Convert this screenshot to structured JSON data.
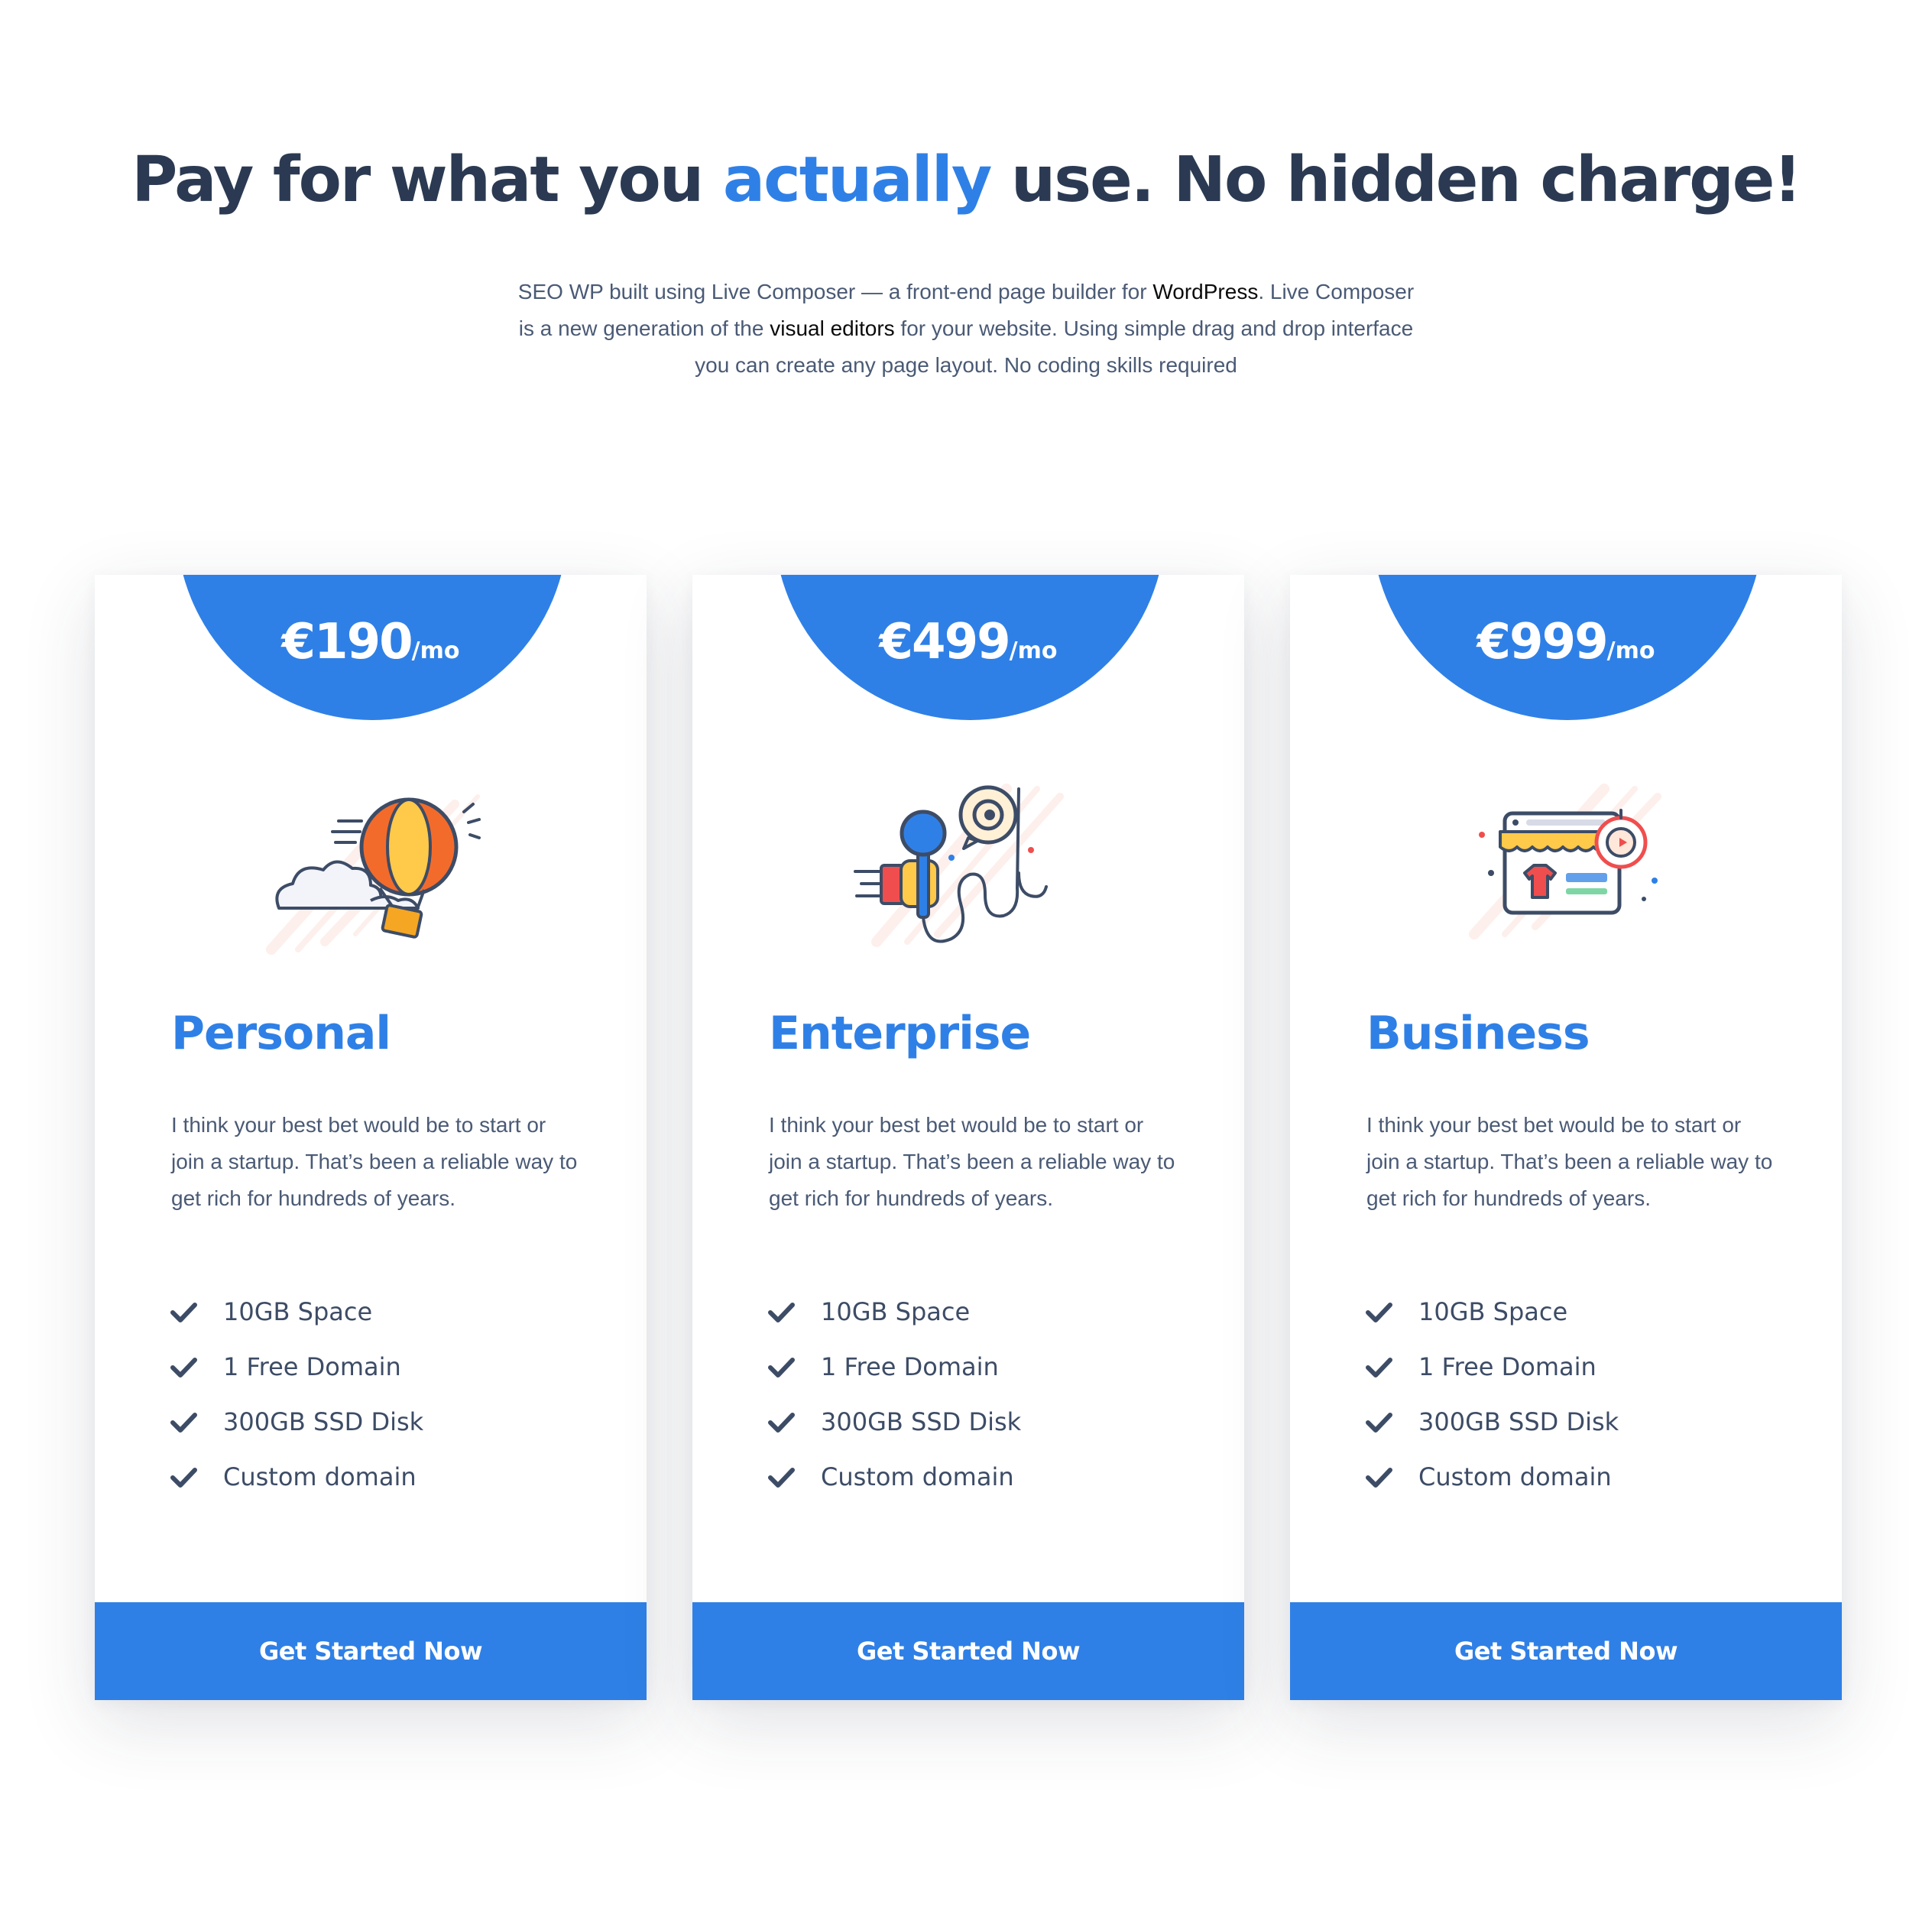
{
  "header": {
    "title_part1": "Pay for what you ",
    "title_accent": "actually",
    "title_part2": " use. No hidden charge!",
    "intro_part1": "SEO WP built using Live Composer — a front-end page builder for ",
    "intro_link1": "WordPress",
    "intro_part2": ". Live Composer is a new generation of the ",
    "intro_link2": "visual editors",
    "intro_part3": " for your website. Using simple drag and drop interface you can create any page layout. No coding skills required"
  },
  "plans": [
    {
      "price": "€190",
      "period": "/mo",
      "illustration": "hot-air-balloon-icon",
      "name": "Personal",
      "description": "I think your best bet would be to start or join a startup. That’s been a reliable way to get rich for hundreds of years.",
      "features": [
        "10GB Space",
        "1 Free Domain",
        "300GB SSD Disk",
        "Custom domain"
      ],
      "cta": "Get Started Now"
    },
    {
      "price": "€499",
      "period": "/mo",
      "illustration": "microphone-speech-icon",
      "name": "Enterprise",
      "description": "I think your best bet would be to start or join a startup. That’s been a reliable way to get rich for hundreds of years.",
      "features": [
        "10GB Space",
        "1 Free Domain",
        "300GB SSD Disk",
        "Custom domain"
      ],
      "cta": "Get Started Now"
    },
    {
      "price": "€999",
      "period": "/mo",
      "illustration": "online-store-icon",
      "name": "Business",
      "description": "I think your best bet would be to start or join a startup. That’s been a reliable way to get rich for hundreds of years.",
      "features": [
        "10GB Space",
        "1 Free Domain",
        "300GB SSD Disk",
        "Custom domain"
      ],
      "cta": "Get Started Now"
    }
  ],
  "colors": {
    "accent": "#2f80e6",
    "heading": "#2b3a52",
    "body_text": "#4a5a75",
    "check": "#3d4c66"
  },
  "icons": {
    "feature_check": "check-icon"
  }
}
